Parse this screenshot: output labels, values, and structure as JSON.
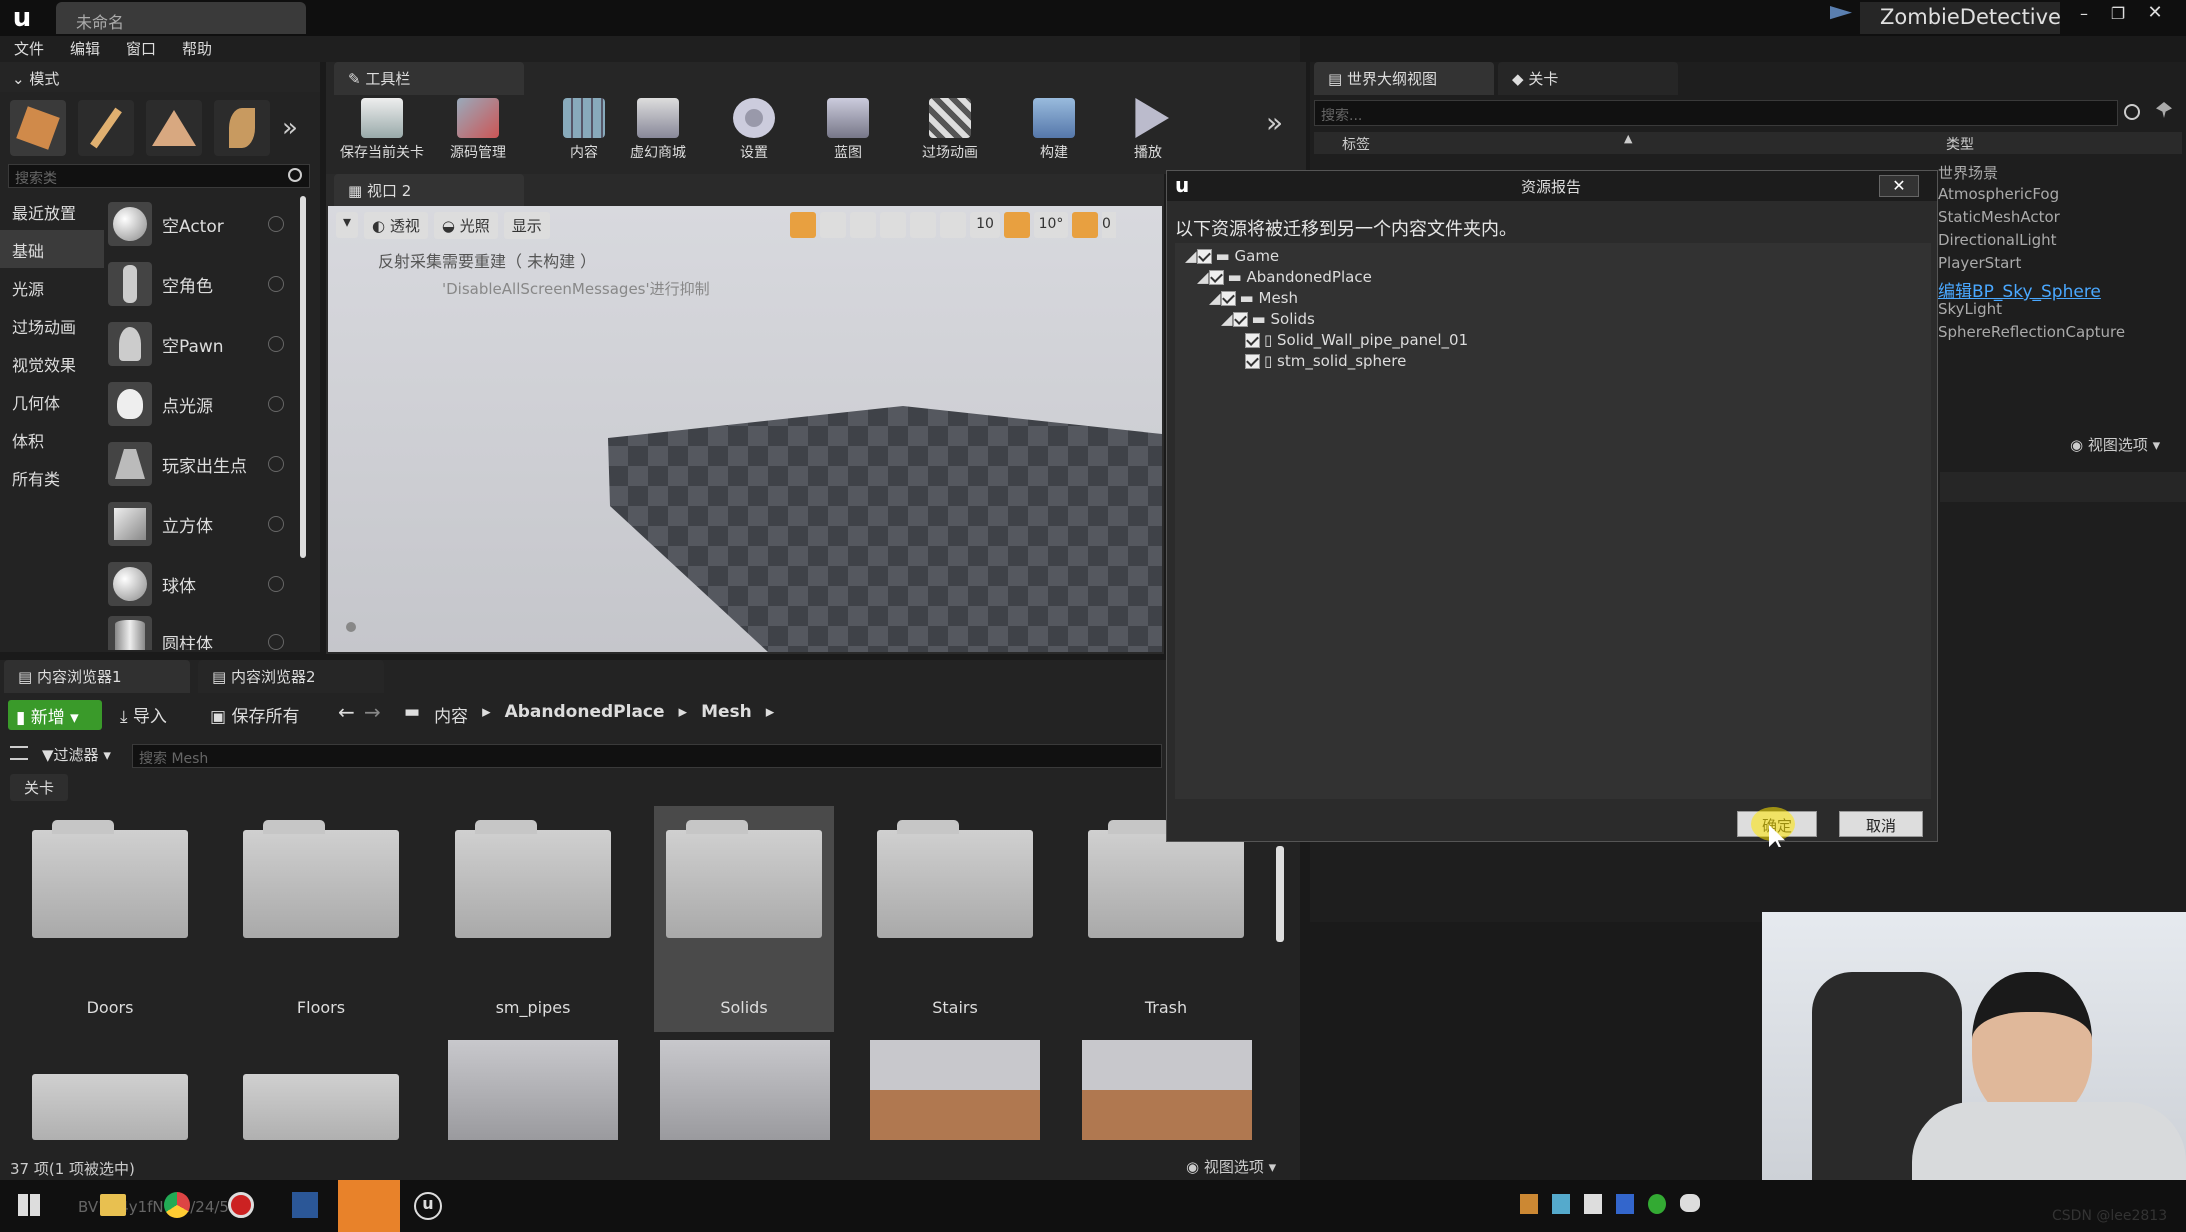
{
  "app": {
    "title": "未命名",
    "project": "ZombieDetective"
  },
  "menu": [
    "文件",
    "编辑",
    "窗口",
    "帮助"
  ],
  "modes": {
    "title": "模式",
    "search_placeholder": "搜索类",
    "categories": [
      "最近放置",
      "基础",
      "光源",
      "过场动画",
      "视觉效果",
      "几何体",
      "体积",
      "所有类"
    ],
    "items": [
      "空Actor",
      "空角色",
      "空Pawn",
      "点光源",
      "玩家出生点",
      "立方体",
      "球体",
      "圆柱体"
    ]
  },
  "toolbar": {
    "title": "工具栏",
    "buttons": [
      "保存当前关卡",
      "源码管理",
      "内容",
      "虚幻商城",
      "设置",
      "蓝图",
      "过场动画",
      "构建",
      "播放"
    ]
  },
  "viewport": {
    "title": "视口 2",
    "perspective": "透视",
    "lit": "光照",
    "show": "显示",
    "grid_value": "10",
    "angle_value": "10°",
    "msg1": "反射采集需要重建（ 未构建 ）",
    "msg2": "'DisableAllScreenMessages'进行抑制",
    "snap_partial": "0"
  },
  "outliner": {
    "tab1": "世界大纲视图",
    "tab2": "关卡",
    "search_placeholder": "搜索...",
    "col_label": "标签",
    "col_type": "类型",
    "items": [
      "世界场景",
      "AtmosphericFog",
      "StaticMeshActor",
      "DirectionalLight",
      "PlayerStart",
      "编辑BP_Sky_Sphere",
      "SkyLight",
      "SphereReflectionCapture"
    ],
    "view_options": "视图选项"
  },
  "dialog": {
    "title": "资源报告",
    "message": "以下资源将被迁移到另一个内容文件夹内。",
    "tree": [
      {
        "label": "Game",
        "depth": 0
      },
      {
        "label": "AbandonedPlace",
        "depth": 1
      },
      {
        "label": "Mesh",
        "depth": 2
      },
      {
        "label": "Solids",
        "depth": 3
      },
      {
        "label": "Solid_Wall_pipe_panel_01",
        "depth": 4
      },
      {
        "label": "stm_solid_sphere",
        "depth": 4
      }
    ],
    "ok": "确定",
    "cancel": "取消"
  },
  "content": {
    "tab1": "内容浏览器1",
    "tab2": "内容浏览器2",
    "new": "新增",
    "import": "导入",
    "save_all": "保存所有",
    "path": [
      "内容",
      "AbandonedPlace",
      "Mesh"
    ],
    "filter": "过滤器",
    "search_placeholder": "搜索 Mesh",
    "level_chip": "关卡",
    "folders": [
      "Doors",
      "Floors",
      "sm_pipes",
      "Solids",
      "Stairs",
      "Trash"
    ],
    "status": "37 项(1 项被选中)",
    "view_options": "视图选项"
  },
  "watermark": "CSDN @lee2813",
  "taskbar": {
    "partial_text": "BV1D4y1fNw 2/24/57"
  }
}
